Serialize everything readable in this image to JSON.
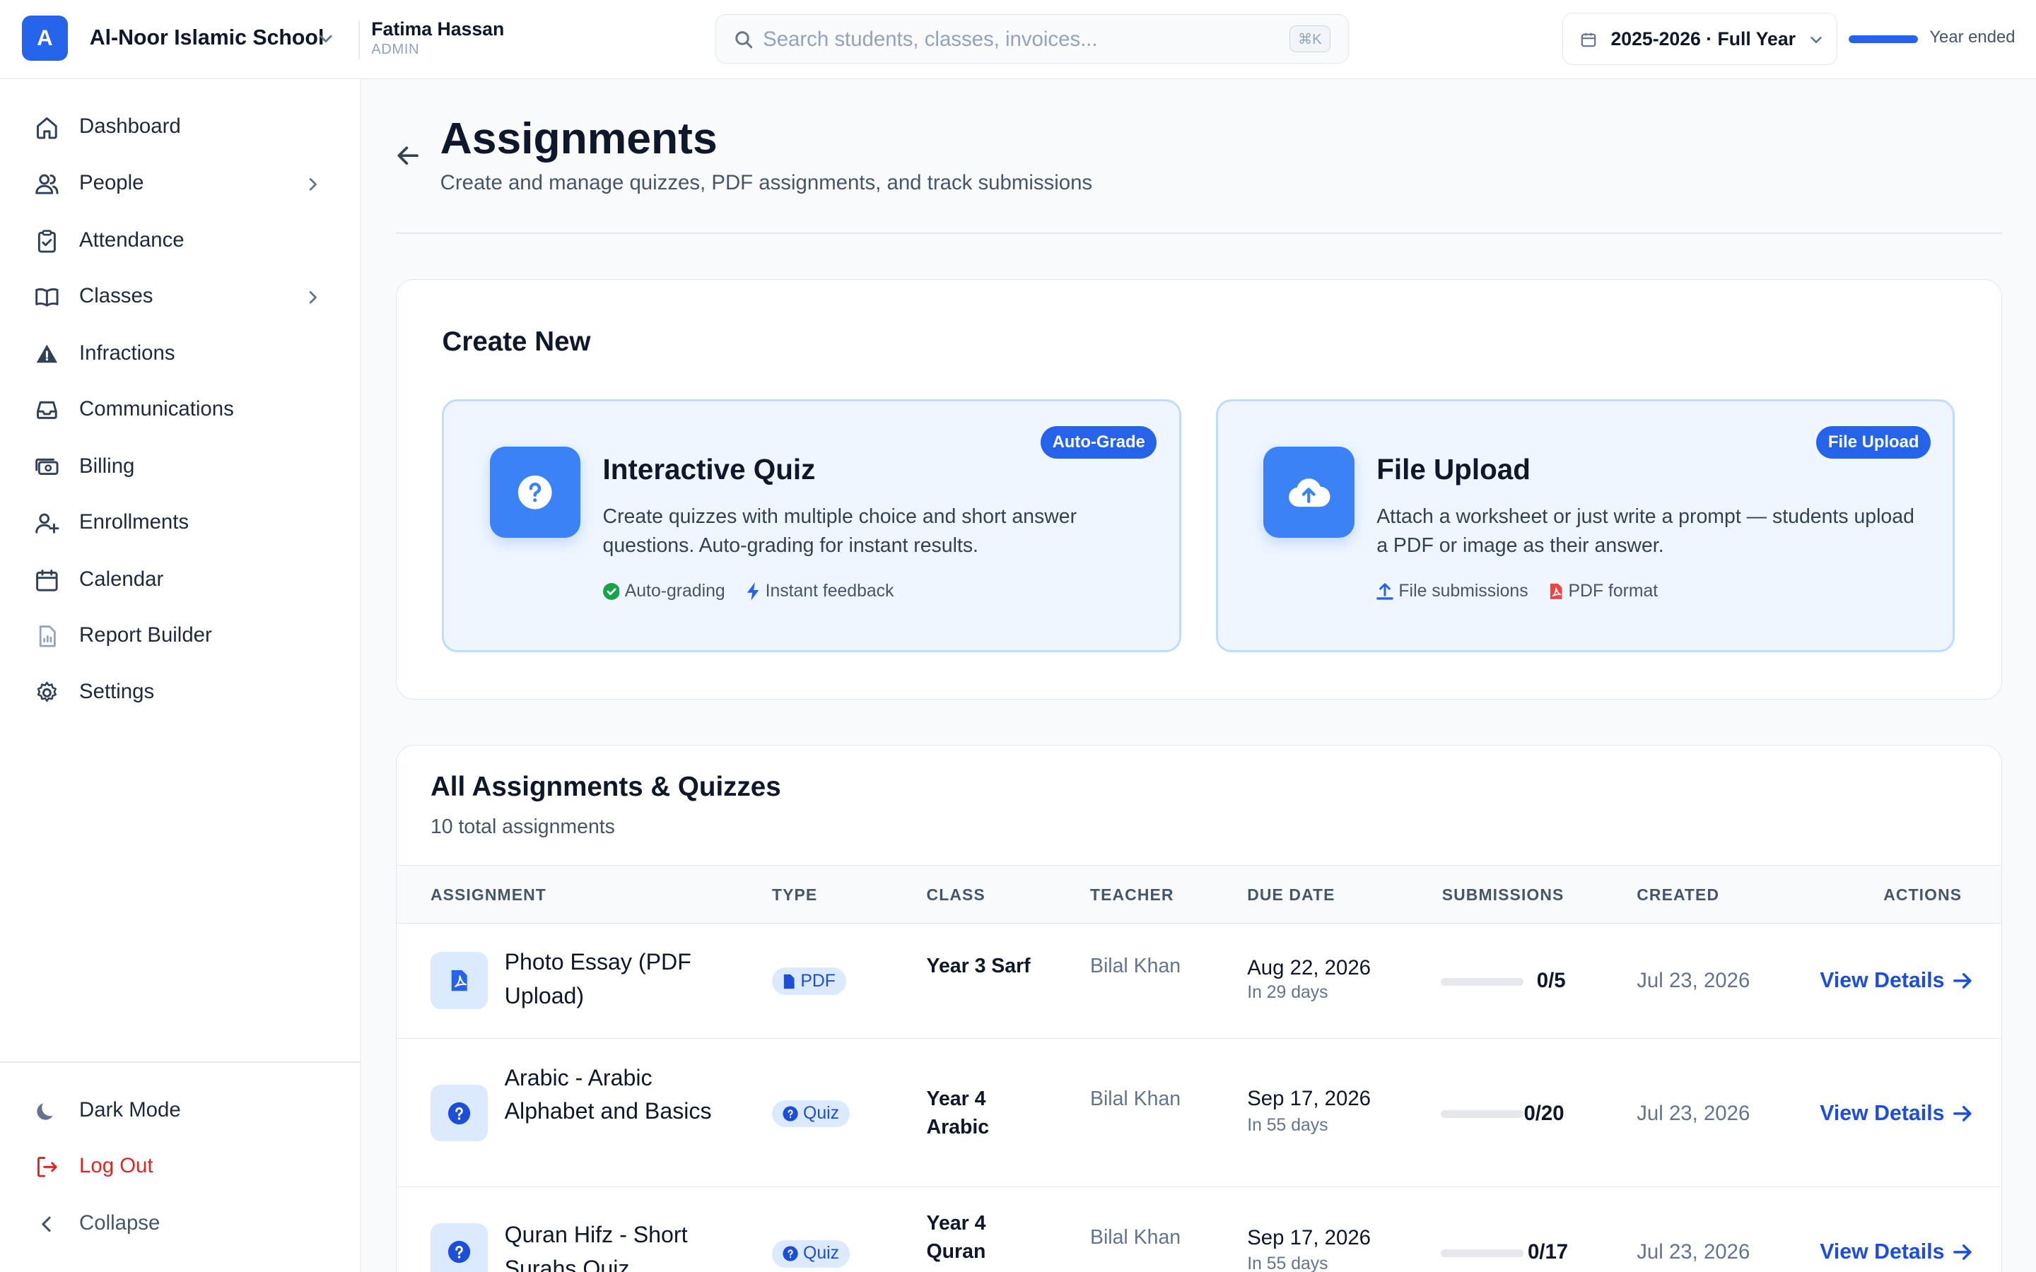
{
  "header": {
    "school_initial": "A",
    "school_name": "Al-Noor Islamic School",
    "user_name": "Fatima Hassan",
    "user_role": "ADMIN",
    "search_placeholder": "Search students, classes, invoices...",
    "search_shortcut": "⌘K",
    "academic_year": "2025-2026 · Full Year",
    "year_progress": 1.0,
    "year_status": "Year ended"
  },
  "sidebar": {
    "items": [
      {
        "label": "Dashboard",
        "icon": "home-icon"
      },
      {
        "label": "People",
        "icon": "users-icon",
        "has_children": true
      },
      {
        "label": "Attendance",
        "icon": "clipboard-check-icon"
      },
      {
        "label": "Classes",
        "icon": "book-open-icon",
        "has_children": true
      },
      {
        "label": "Infractions",
        "icon": "warning-icon"
      },
      {
        "label": "Communications",
        "icon": "inbox-icon"
      },
      {
        "label": "Billing",
        "icon": "cash-icon"
      },
      {
        "label": "Enrollments",
        "icon": "user-plus-icon"
      },
      {
        "label": "Calendar",
        "icon": "calendar-icon"
      },
      {
        "label": "Report Builder",
        "icon": "report-icon"
      },
      {
        "label": "Settings",
        "icon": "gear-icon"
      }
    ],
    "footer": {
      "dark_mode": "Dark Mode",
      "logout": "Log Out",
      "collapse": "Collapse"
    }
  },
  "page": {
    "title": "Assignments",
    "subtitle": "Create and manage quizzes, PDF assignments, and track submissions"
  },
  "create_new": {
    "title": "Create New",
    "quiz": {
      "title": "Interactive Quiz",
      "badge": "Auto-Grade",
      "description": "Create quizzes with multiple choice and short answer questions. Auto-grading for instant results.",
      "feature_1": "Auto-grading",
      "feature_2": "Instant feedback"
    },
    "upload": {
      "title": "File Upload",
      "badge": "File Upload",
      "description": "Attach a worksheet or just write a prompt — students upload a PDF or image as their answer.",
      "feature_1": "File submissions",
      "feature_2": "PDF format"
    }
  },
  "assignments": {
    "title": "All Assignments & Quizzes",
    "count": "10 total assignments",
    "columns": [
      "ASSIGNMENT",
      "TYPE",
      "CLASS",
      "TEACHER",
      "DUE DATE",
      "SUBMISSIONS",
      "CREATED",
      "ACTIONS"
    ],
    "rows": [
      {
        "name": "Photo Essay (PDF Upload)",
        "type": "PDF",
        "class": "Year 3 Sarf",
        "teacher": "Bilal Khan",
        "due": "Aug 22, 2026",
        "due_rel": "In 29 days",
        "submissions": "0/5",
        "submitted_fraction": 0,
        "created": "Jul 23, 2026",
        "action": "View Details"
      },
      {
        "name": "Arabic - Arabic Alphabet and Basics",
        "type": "Quiz",
        "class": "Year 4 Arabic",
        "teacher": "Bilal Khan",
        "due": "Sep 17, 2026",
        "due_rel": "In 55 days",
        "submissions": "0/20",
        "submitted_fraction": 0,
        "created": "Jul 23, 2026",
        "action": "View Details"
      },
      {
        "name": "Quran Hifz - Short Surahs Quiz",
        "type": "Quiz",
        "class": "Year 4 Quran",
        "teacher": "Bilal Khan",
        "due": "Sep 17, 2026",
        "due_rel": "In 55 days",
        "submissions": "0/17",
        "submitted_fraction": 0,
        "created": "Jul 23, 2026",
        "action": "View Details"
      }
    ]
  }
}
